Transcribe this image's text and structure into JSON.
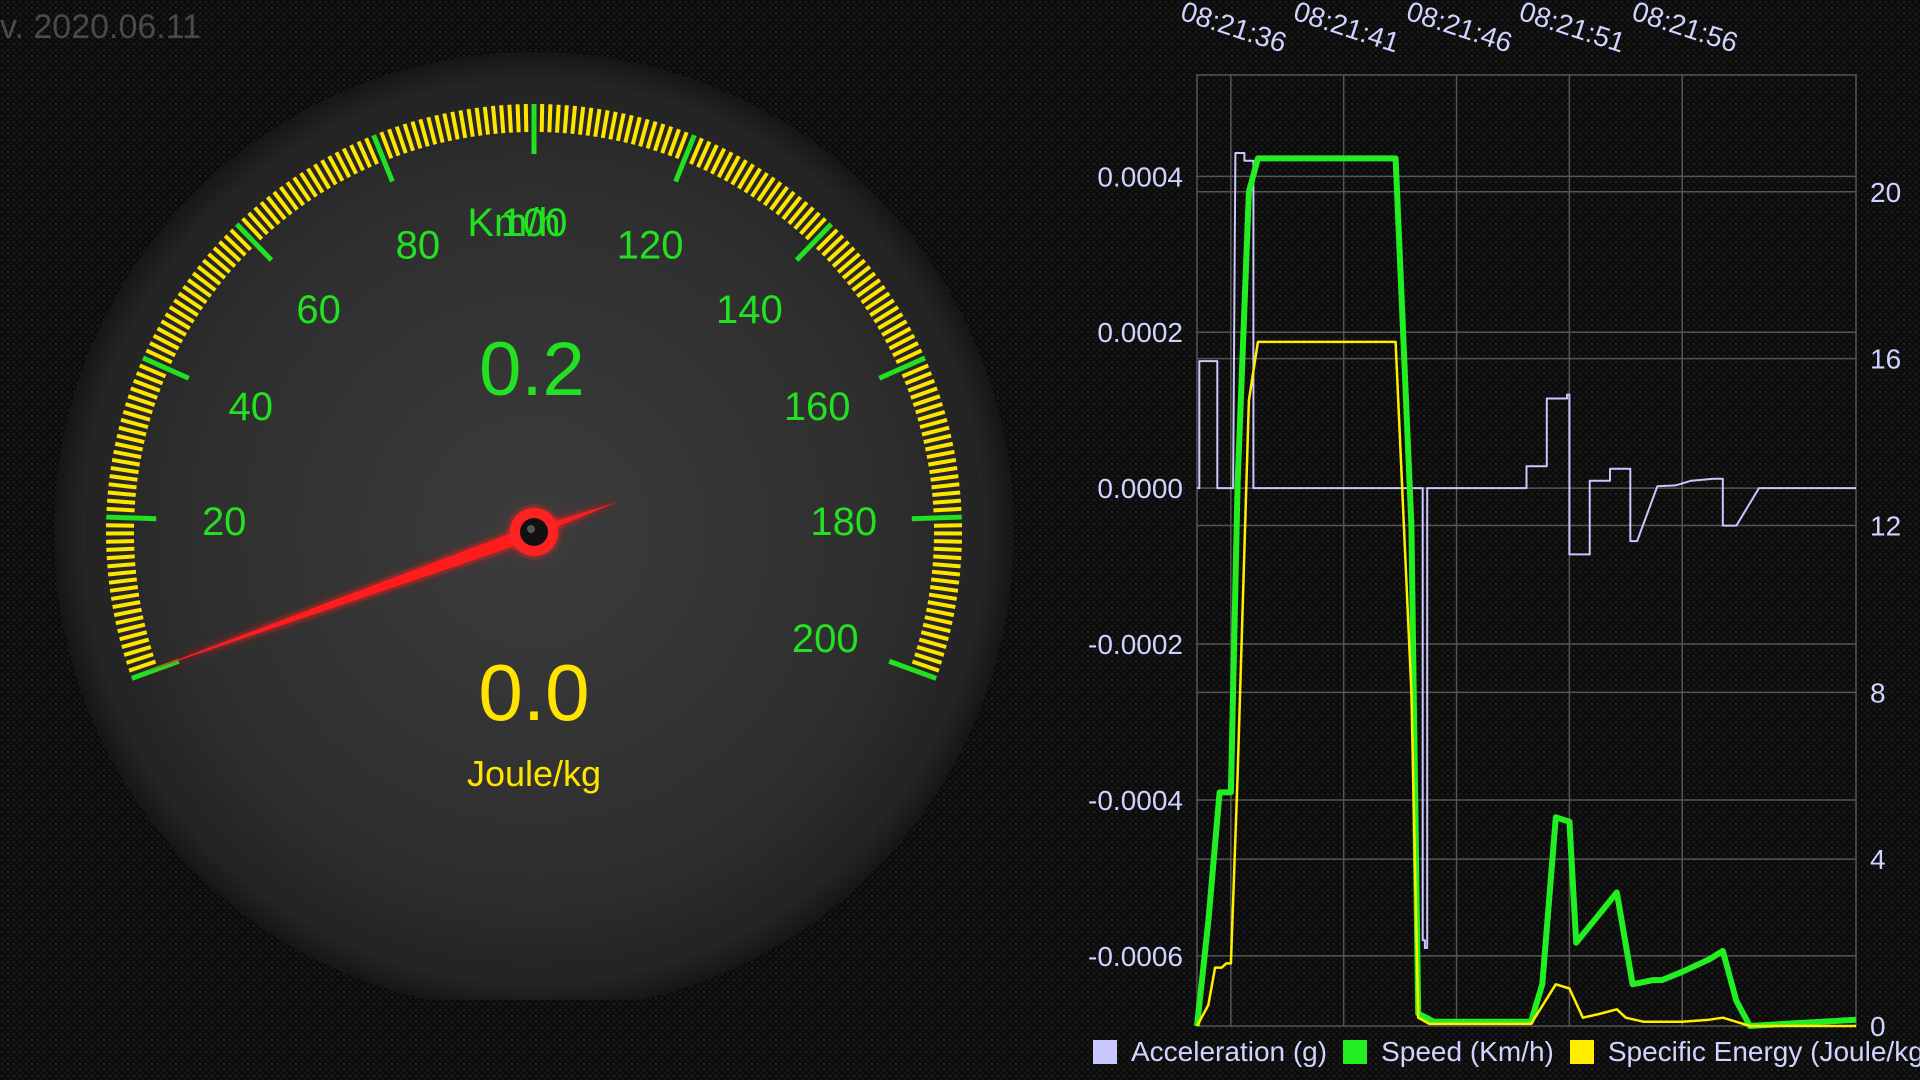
{
  "app": {
    "version": "v. 2020.06.11"
  },
  "gauge": {
    "speed_value": "0.2",
    "speed_unit": "Km/h",
    "energy_value": "0.0",
    "energy_unit": "Joule/kg",
    "needle_speed": 0.2,
    "scale_min": 0,
    "scale_max": 200,
    "scale_labels": [
      "20",
      "40",
      "60",
      "80",
      "100",
      "120",
      "140",
      "160",
      "180",
      "200"
    ],
    "colors": {
      "tick": "#ffe400",
      "label": "#22e022",
      "needle": "#ff1a1a",
      "energy": "#ffe400"
    }
  },
  "chart_data": {
    "type": "line",
    "x_ticks": [
      "08:21:36",
      "08:21:41",
      "08:21:46",
      "08:21:51",
      "08:21:56"
    ],
    "left_axis": {
      "ticks": [
        "0.0004",
        "0.0002",
        "0.0000",
        "-0.0002",
        "-0.0004",
        "-0.0006"
      ],
      "tick_values": [
        0.0004,
        0.0002,
        0.0,
        -0.0002,
        -0.0004,
        -0.0006
      ],
      "range": [
        -0.00069,
        0.00053
      ]
    },
    "right_axis": {
      "ticks": [
        "20",
        "16",
        "12",
        "8",
        "4",
        "0"
      ],
      "tick_values": [
        20,
        16,
        12,
        8,
        4,
        0
      ],
      "range": [
        0,
        22.8
      ]
    },
    "x_range": [
      34.5,
      63.7
    ],
    "grid": true,
    "legend_position": "bottom",
    "series": [
      {
        "name": "Acceleration (g)",
        "color": "#c8c8ff",
        "axis": "left",
        "x": [
          34.5,
          34.6,
          34.6,
          35.4,
          35.4,
          36.1,
          36.1,
          36.2,
          36.6,
          36.6,
          37.0,
          37.0,
          44.5,
          44.5,
          44.5,
          44.6,
          44.6,
          44.7,
          44.7,
          49.1,
          49.1,
          50.0,
          50.0,
          50.9,
          50.9,
          51.0,
          51.0,
          51.9,
          51.9,
          52.8,
          52.8,
          53.7,
          53.7,
          54.0,
          54.0,
          54.9,
          54.9,
          55.7,
          55.7,
          56.4,
          56.4,
          57.4,
          57.4,
          57.8,
          57.8,
          58.4,
          58.4,
          59.4,
          59.4,
          63.7
        ],
        "y": [
          0.0,
          0.0,
          0.000163,
          0.000163,
          0.0,
          0.0,
          0.0,
          0.00043,
          0.00043,
          0.00042,
          0.00042,
          0.0,
          0.0,
          0.0,
          -0.00058,
          -0.00058,
          -0.00059,
          -0.00059,
          0.0,
          0.0,
          2.8e-05,
          2.8e-05,
          0.000115,
          0.000115,
          0.00012,
          0.00012,
          -8.5e-05,
          -8.5e-05,
          9.5e-06,
          9.5e-06,
          2.5e-05,
          2.5e-05,
          -6.8e-05,
          -6.8e-05,
          -6.8e-05,
          2.5e-06,
          2.5e-06,
          3.5e-06,
          3.5e-06,
          9.5e-06,
          9.5e-06,
          1.2e-05,
          1.2e-05,
          1.2e-05,
          -4.8e-05,
          -4.8e-05,
          -4.8e-05,
          0.0,
          0.0,
          0.0
        ]
      },
      {
        "name": "Speed (Km/h)",
        "color": "#22ee22",
        "axis": "right",
        "x": [
          34.5,
          35.0,
          35.5,
          35.7,
          36.0,
          36.3,
          36.8,
          37.2,
          37.5,
          38.5,
          41.5,
          43.3,
          44.0,
          44.3,
          45.0,
          48.5,
          49.3,
          49.8,
          50.4,
          51.0,
          51.3,
          52.2,
          53.1,
          53.8,
          54.7,
          55.1,
          56.0,
          57.2,
          57.8,
          58.4,
          59.0,
          60.5,
          62.2,
          63.7
        ],
        "y": [
          0.0,
          2.5,
          5.6,
          5.6,
          5.6,
          13.0,
          20.0,
          20.8,
          20.8,
          20.8,
          20.8,
          20.8,
          12.0,
          0.3,
          0.1,
          0.1,
          0.1,
          1.0,
          5.0,
          4.9,
          2.0,
          2.6,
          3.2,
          1.0,
          1.1,
          1.1,
          1.3,
          1.6,
          1.8,
          0.6,
          0.0,
          0.05,
          0.1,
          0.15
        ]
      },
      {
        "name": "Specific Energy (Joule/kg)",
        "color": "#ffee00",
        "axis": "right",
        "x": [
          34.5,
          35.0,
          35.3,
          35.6,
          35.8,
          36.0,
          36.3,
          36.8,
          37.2,
          37.5,
          38.5,
          41.5,
          43.3,
          44.0,
          44.3,
          44.8,
          48.5,
          49.3,
          50.4,
          51.0,
          51.6,
          52.4,
          53.1,
          53.5,
          54.3,
          56.0,
          57.2,
          57.8,
          58.4,
          59.0,
          63.7
        ],
        "y": [
          0.0,
          0.5,
          1.4,
          1.4,
          1.5,
          1.5,
          6.0,
          15.0,
          16.4,
          16.4,
          16.4,
          16.4,
          16.4,
          8.0,
          0.2,
          0.05,
          0.05,
          0.05,
          1.0,
          0.9,
          0.2,
          0.3,
          0.4,
          0.2,
          0.1,
          0.1,
          0.15,
          0.2,
          0.1,
          0.0,
          0.0
        ]
      }
    ]
  }
}
